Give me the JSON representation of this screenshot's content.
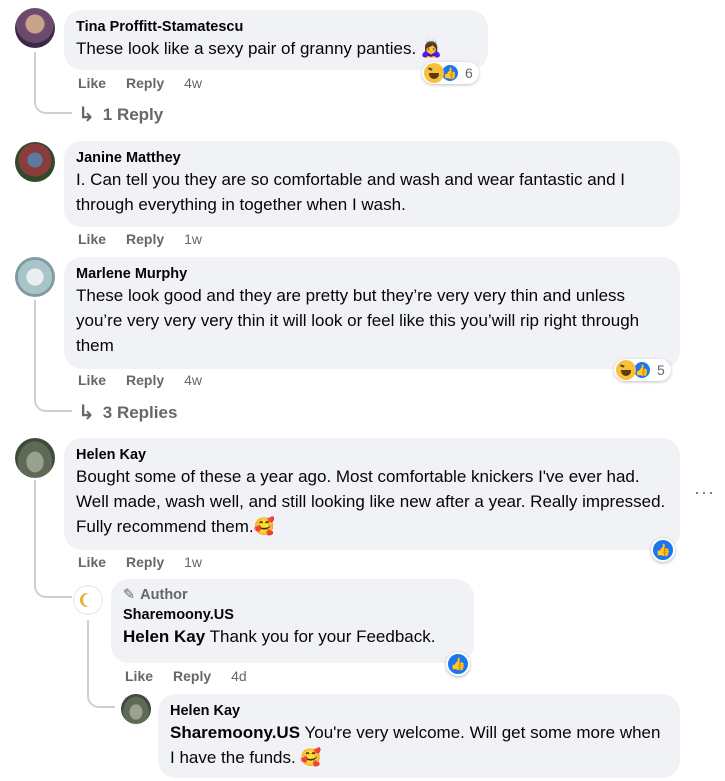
{
  "comments": [
    {
      "author": "Tina Proffitt-Stamatescu",
      "text": "These look like a sexy pair of granny panties. 🙇‍♀️",
      "like": "Like",
      "reply": "Reply",
      "time": "4w",
      "reaction_count": "6",
      "replies_label": "1 Reply"
    },
    {
      "author": "Janine Matthey",
      "text": "I. Can tell you they are so comfortable and wash and wear fantastic and I through everything in together when I wash.",
      "like": "Like",
      "reply": "Reply",
      "time": "1w"
    },
    {
      "author": "Marlene Murphy",
      "text": "These look good and they are pretty but they’re very very thin and unless you’re very very very thin it will look or feel like this you’will rip right through them",
      "like": "Like",
      "reply": "Reply",
      "time": "4w",
      "reaction_count": "5",
      "replies_label": "3 Replies"
    },
    {
      "author": "Helen Kay",
      "text": "Bought some of these a year ago. Most comfortable knickers I've ever had. Well made, wash well, and still looking like new after a year. Really impressed. Fully recommend them.🥰",
      "like": "Like",
      "reply": "Reply",
      "time": "1w",
      "more": "···"
    }
  ],
  "replies": [
    {
      "badge": "Author",
      "author": "Sharemoony.US",
      "tag": "Helen Kay",
      "text": " Thank you for your Feedback.",
      "like": "Like",
      "reply": "Reply",
      "time": "4d"
    },
    {
      "author": "Helen Kay",
      "tag": "Sharemoony.US",
      "text": " You're very welcome. Will get some more when I have the funds. 🥰"
    }
  ],
  "icons": {
    "reply_arrow": "↳",
    "pencil": "✎",
    "thumb": "👍"
  },
  "colors": {
    "bubble": "#f0f2f5",
    "secondary_text": "#65676b",
    "like_blue": "#1877f2"
  }
}
